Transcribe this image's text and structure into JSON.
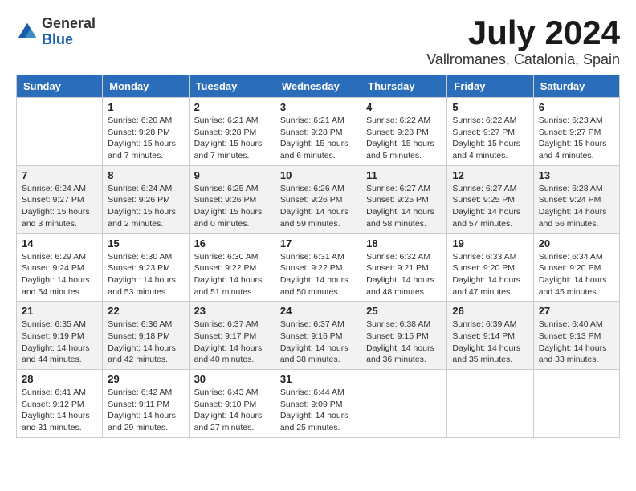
{
  "logo": {
    "general": "General",
    "blue": "Blue"
  },
  "title": {
    "month": "July 2024",
    "location": "Vallromanes, Catalonia, Spain"
  },
  "columns": [
    "Sunday",
    "Monday",
    "Tuesday",
    "Wednesday",
    "Thursday",
    "Friday",
    "Saturday"
  ],
  "weeks": [
    [
      {
        "day": "",
        "sunrise": "",
        "sunset": "",
        "daylight": ""
      },
      {
        "day": "1",
        "sunrise": "Sunrise: 6:20 AM",
        "sunset": "Sunset: 9:28 PM",
        "daylight": "Daylight: 15 hours and 7 minutes."
      },
      {
        "day": "2",
        "sunrise": "Sunrise: 6:21 AM",
        "sunset": "Sunset: 9:28 PM",
        "daylight": "Daylight: 15 hours and 7 minutes."
      },
      {
        "day": "3",
        "sunrise": "Sunrise: 6:21 AM",
        "sunset": "Sunset: 9:28 PM",
        "daylight": "Daylight: 15 hours and 6 minutes."
      },
      {
        "day": "4",
        "sunrise": "Sunrise: 6:22 AM",
        "sunset": "Sunset: 9:28 PM",
        "daylight": "Daylight: 15 hours and 5 minutes."
      },
      {
        "day": "5",
        "sunrise": "Sunrise: 6:22 AM",
        "sunset": "Sunset: 9:27 PM",
        "daylight": "Daylight: 15 hours and 4 minutes."
      },
      {
        "day": "6",
        "sunrise": "Sunrise: 6:23 AM",
        "sunset": "Sunset: 9:27 PM",
        "daylight": "Daylight: 15 hours and 4 minutes."
      }
    ],
    [
      {
        "day": "7",
        "sunrise": "Sunrise: 6:24 AM",
        "sunset": "Sunset: 9:27 PM",
        "daylight": "Daylight: 15 hours and 3 minutes."
      },
      {
        "day": "8",
        "sunrise": "Sunrise: 6:24 AM",
        "sunset": "Sunset: 9:26 PM",
        "daylight": "Daylight: 15 hours and 2 minutes."
      },
      {
        "day": "9",
        "sunrise": "Sunrise: 6:25 AM",
        "sunset": "Sunset: 9:26 PM",
        "daylight": "Daylight: 15 hours and 0 minutes."
      },
      {
        "day": "10",
        "sunrise": "Sunrise: 6:26 AM",
        "sunset": "Sunset: 9:26 PM",
        "daylight": "Daylight: 14 hours and 59 minutes."
      },
      {
        "day": "11",
        "sunrise": "Sunrise: 6:27 AM",
        "sunset": "Sunset: 9:25 PM",
        "daylight": "Daylight: 14 hours and 58 minutes."
      },
      {
        "day": "12",
        "sunrise": "Sunrise: 6:27 AM",
        "sunset": "Sunset: 9:25 PM",
        "daylight": "Daylight: 14 hours and 57 minutes."
      },
      {
        "day": "13",
        "sunrise": "Sunrise: 6:28 AM",
        "sunset": "Sunset: 9:24 PM",
        "daylight": "Daylight: 14 hours and 56 minutes."
      }
    ],
    [
      {
        "day": "14",
        "sunrise": "Sunrise: 6:29 AM",
        "sunset": "Sunset: 9:24 PM",
        "daylight": "Daylight: 14 hours and 54 minutes."
      },
      {
        "day": "15",
        "sunrise": "Sunrise: 6:30 AM",
        "sunset": "Sunset: 9:23 PM",
        "daylight": "Daylight: 14 hours and 53 minutes."
      },
      {
        "day": "16",
        "sunrise": "Sunrise: 6:30 AM",
        "sunset": "Sunset: 9:22 PM",
        "daylight": "Daylight: 14 hours and 51 minutes."
      },
      {
        "day": "17",
        "sunrise": "Sunrise: 6:31 AM",
        "sunset": "Sunset: 9:22 PM",
        "daylight": "Daylight: 14 hours and 50 minutes."
      },
      {
        "day": "18",
        "sunrise": "Sunrise: 6:32 AM",
        "sunset": "Sunset: 9:21 PM",
        "daylight": "Daylight: 14 hours and 48 minutes."
      },
      {
        "day": "19",
        "sunrise": "Sunrise: 6:33 AM",
        "sunset": "Sunset: 9:20 PM",
        "daylight": "Daylight: 14 hours and 47 minutes."
      },
      {
        "day": "20",
        "sunrise": "Sunrise: 6:34 AM",
        "sunset": "Sunset: 9:20 PM",
        "daylight": "Daylight: 14 hours and 45 minutes."
      }
    ],
    [
      {
        "day": "21",
        "sunrise": "Sunrise: 6:35 AM",
        "sunset": "Sunset: 9:19 PM",
        "daylight": "Daylight: 14 hours and 44 minutes."
      },
      {
        "day": "22",
        "sunrise": "Sunrise: 6:36 AM",
        "sunset": "Sunset: 9:18 PM",
        "daylight": "Daylight: 14 hours and 42 minutes."
      },
      {
        "day": "23",
        "sunrise": "Sunrise: 6:37 AM",
        "sunset": "Sunset: 9:17 PM",
        "daylight": "Daylight: 14 hours and 40 minutes."
      },
      {
        "day": "24",
        "sunrise": "Sunrise: 6:37 AM",
        "sunset": "Sunset: 9:16 PM",
        "daylight": "Daylight: 14 hours and 38 minutes."
      },
      {
        "day": "25",
        "sunrise": "Sunrise: 6:38 AM",
        "sunset": "Sunset: 9:15 PM",
        "daylight": "Daylight: 14 hours and 36 minutes."
      },
      {
        "day": "26",
        "sunrise": "Sunrise: 6:39 AM",
        "sunset": "Sunset: 9:14 PM",
        "daylight": "Daylight: 14 hours and 35 minutes."
      },
      {
        "day": "27",
        "sunrise": "Sunrise: 6:40 AM",
        "sunset": "Sunset: 9:13 PM",
        "daylight": "Daylight: 14 hours and 33 minutes."
      }
    ],
    [
      {
        "day": "28",
        "sunrise": "Sunrise: 6:41 AM",
        "sunset": "Sunset: 9:12 PM",
        "daylight": "Daylight: 14 hours and 31 minutes."
      },
      {
        "day": "29",
        "sunrise": "Sunrise: 6:42 AM",
        "sunset": "Sunset: 9:11 PM",
        "daylight": "Daylight: 14 hours and 29 minutes."
      },
      {
        "day": "30",
        "sunrise": "Sunrise: 6:43 AM",
        "sunset": "Sunset: 9:10 PM",
        "daylight": "Daylight: 14 hours and 27 minutes."
      },
      {
        "day": "31",
        "sunrise": "Sunrise: 6:44 AM",
        "sunset": "Sunset: 9:09 PM",
        "daylight": "Daylight: 14 hours and 25 minutes."
      },
      {
        "day": "",
        "sunrise": "",
        "sunset": "",
        "daylight": ""
      },
      {
        "day": "",
        "sunrise": "",
        "sunset": "",
        "daylight": ""
      },
      {
        "day": "",
        "sunrise": "",
        "sunset": "",
        "daylight": ""
      }
    ]
  ]
}
